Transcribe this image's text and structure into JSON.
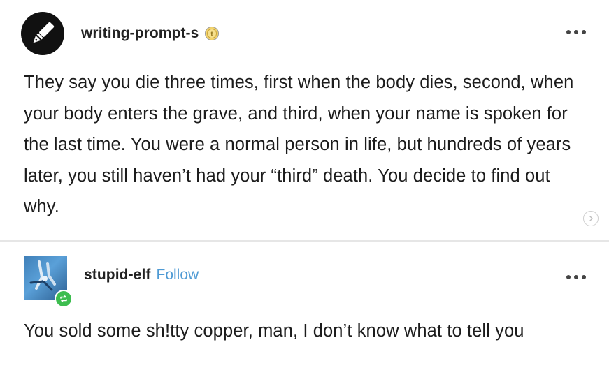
{
  "post1": {
    "username": "writing-prompt-s",
    "avatar_icon": "pen-nib-icon",
    "badge_icon": "coin-badge-icon",
    "text": "They say you die three times, first when the body dies, second, when your body enters the grave, and third, when your name is spoken for the last time. You were a normal person in life, but hundreds of years later, you still haven’t had your “third” death. You decide to find out why."
  },
  "post2": {
    "username": "stupid-elf",
    "follow_label": "Follow",
    "avatar_icon": "blue-avatar",
    "badge_icon": "reblog-icon",
    "text": "You sold some sh!tty copper, man, I don’t know what to tell you"
  },
  "colors": {
    "follow": "#4e9ad4",
    "reblog": "#3dbd4f",
    "avatar1": "#111111"
  }
}
